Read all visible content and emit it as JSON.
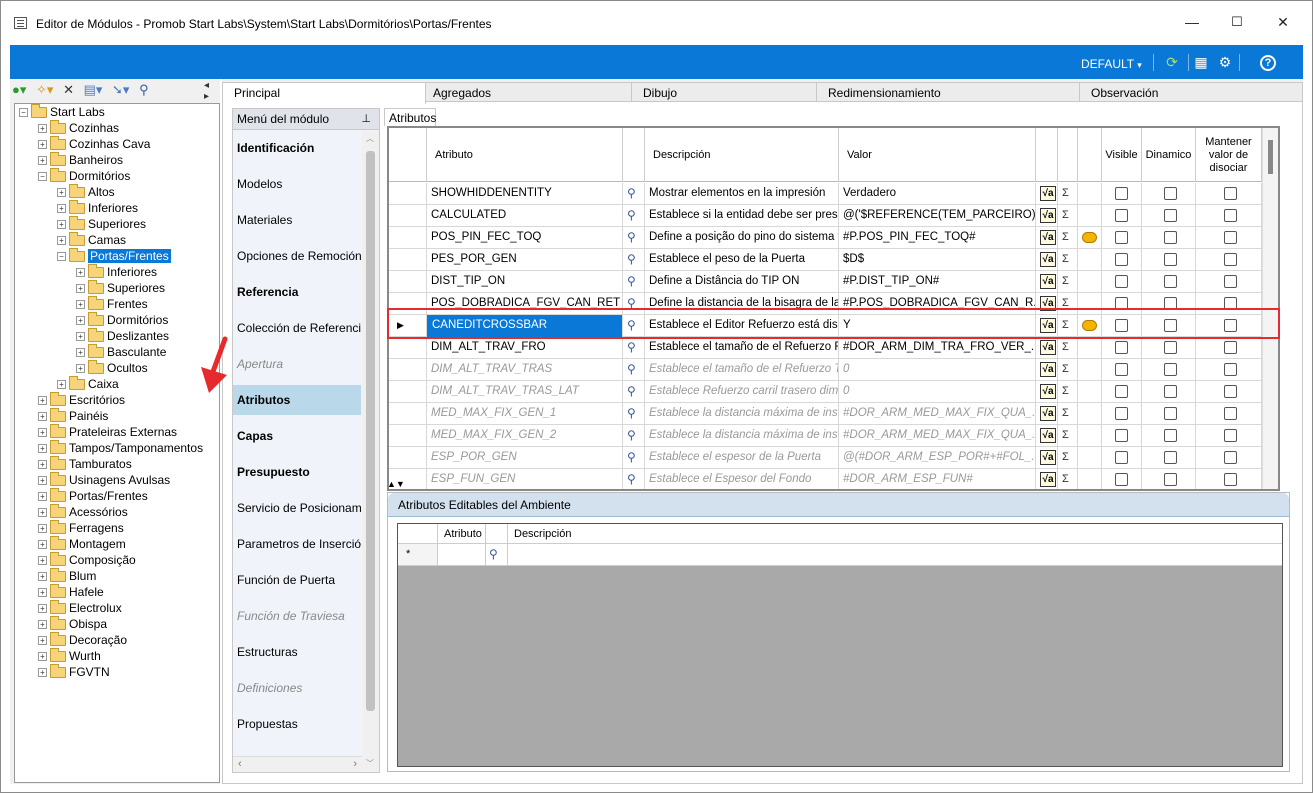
{
  "window": {
    "title": "Editor de Módulos - Promob Start Labs\\System\\Start Labs\\Dormitórios\\Portas/Frentes",
    "minimize": "—",
    "maximize": "☐",
    "close": "✕"
  },
  "topbar": {
    "profile": "DEFAULT",
    "profile_caret": "▾",
    "icons": [
      "refresh-icon",
      "layout-icon",
      "settings-icon",
      "help-icon"
    ]
  },
  "tree": {
    "items": [
      {
        "label": "Start Labs",
        "level": 0,
        "expanded": true
      },
      {
        "label": "Cozinhas",
        "level": 1
      },
      {
        "label": "Cozinhas Cava",
        "level": 1
      },
      {
        "label": "Banheiros",
        "level": 1
      },
      {
        "label": "Dormitórios",
        "level": 1,
        "expanded": true
      },
      {
        "label": "Altos",
        "level": 2
      },
      {
        "label": "Inferiores",
        "level": 2
      },
      {
        "label": "Superiores",
        "level": 2
      },
      {
        "label": "Camas",
        "level": 2
      },
      {
        "label": "Portas/Frentes",
        "level": 2,
        "expanded": true,
        "selected": true
      },
      {
        "label": "Inferiores",
        "level": 3
      },
      {
        "label": "Superiores",
        "level": 3
      },
      {
        "label": "Frentes",
        "level": 3
      },
      {
        "label": "Dormitórios",
        "level": 3
      },
      {
        "label": "Deslizantes",
        "level": 3
      },
      {
        "label": "Basculante",
        "level": 3
      },
      {
        "label": "Ocultos",
        "level": 3
      },
      {
        "label": "Caixa",
        "level": 2
      },
      {
        "label": "Escritórios",
        "level": 1
      },
      {
        "label": "Painéis",
        "level": 1
      },
      {
        "label": "Prateleiras Externas",
        "level": 1
      },
      {
        "label": "Tampos/Tamponamentos",
        "level": 1
      },
      {
        "label": "Tamburatos",
        "level": 1
      },
      {
        "label": "Usinagens Avulsas",
        "level": 1
      },
      {
        "label": "Portas/Frentes",
        "level": 1
      },
      {
        "label": "Acessórios",
        "level": 1
      },
      {
        "label": "Ferragens",
        "level": 1
      },
      {
        "label": "Montagem",
        "level": 1
      },
      {
        "label": "Composição",
        "level": 1
      },
      {
        "label": "Blum",
        "level": 1
      },
      {
        "label": "Hafele",
        "level": 1
      },
      {
        "label": "Electrolux",
        "level": 1
      },
      {
        "label": "Obispa",
        "level": 1
      },
      {
        "label": "Decoração",
        "level": 1
      },
      {
        "label": "Wurth",
        "level": 1
      },
      {
        "label": "FGVTN",
        "level": 1
      }
    ]
  },
  "tabs": [
    "Principal",
    "Agregados",
    "Dibujo",
    "Redimensionamiento",
    "Observación"
  ],
  "menu": {
    "header": "Menú del módulo",
    "items": [
      {
        "label": "Identificación",
        "style": "b"
      },
      {
        "label": "Modelos",
        "style": ""
      },
      {
        "label": "Materiales",
        "style": ""
      },
      {
        "label": "Opciones de Remoción",
        "style": ""
      },
      {
        "label": "Referencia",
        "style": "b"
      },
      {
        "label": "Colección de Referencias",
        "style": ""
      },
      {
        "label": "Apertura",
        "style": "g"
      },
      {
        "label": "Atributos",
        "style": "sel"
      },
      {
        "label": "Capas",
        "style": "b"
      },
      {
        "label": "Presupuesto",
        "style": "b"
      },
      {
        "label": "Servicio de Posicionamiento",
        "style": ""
      },
      {
        "label": "Parametros de Inserción",
        "style": ""
      },
      {
        "label": "Función de Puerta",
        "style": ""
      },
      {
        "label": "Función de Traviesa",
        "style": "g"
      },
      {
        "label": "Estructuras",
        "style": ""
      },
      {
        "label": "Definiciones",
        "style": "g"
      },
      {
        "label": "Propuestas",
        "style": ""
      }
    ]
  },
  "subtab": "Atributos",
  "grid": {
    "headers": {
      "atributo": "Atributo",
      "descripcion": "Descripción",
      "valor": "Valor",
      "visible": "Visible",
      "dinamico": "Dinamico",
      "mantener": "Mantener valor de disociar"
    },
    "rows": [
      {
        "attr": "SHOWHIDDENENTITY",
        "desc": "Mostrar elementos en la impresión",
        "val": "Verdadero",
        "i": false,
        "bubble": false
      },
      {
        "attr": "CALCULATED",
        "desc": "Establece si la entidad debe ser pres...",
        "val": "@('$REFERENCE(TEM_PARCEIRO)...",
        "i": false,
        "bubble": false
      },
      {
        "attr": "POS_PIN_FEC_TOQ",
        "desc": "Define a posição do pino do sistema f...",
        "val": "#P.POS_PIN_FEC_TOQ#",
        "i": false,
        "bubble": true
      },
      {
        "attr": "PES_POR_GEN",
        "desc": "Establece el peso de la Puerta",
        "val": "$D$",
        "i": false,
        "bubble": false
      },
      {
        "attr": "DIST_TIP_ON",
        "desc": "Define a Distância do TIP ON",
        "val": "#P.DIST_TIP_ON#",
        "i": false,
        "bubble": false
      },
      {
        "attr": "POS_DOBRADICA_FGV_CAN_RET",
        "desc": "Define la distancia de la bisagra de la...",
        "val": "#P.POS_DOBRADICA_FGV_CAN_R...",
        "i": false,
        "bubble": false
      },
      {
        "attr": "CANEDITCROSSBAR",
        "desc": "Establece el Editor Refuerzo está dis...",
        "val": "Y",
        "i": false,
        "bubble": true,
        "current": true
      },
      {
        "attr": "DIM_ALT_TRAV_FRO",
        "desc": "Establece el tamaño de el Refuerzo F...",
        "val": "#DOR_ARM_DIM_TRA_FRO_VER_...",
        "i": false,
        "bubble": false
      },
      {
        "attr": "DIM_ALT_TRAV_TRAS",
        "desc": "Establece el tamaño de el Refuerzo T...",
        "val": "0",
        "i": true,
        "bubble": false
      },
      {
        "attr": "DIM_ALT_TRAV_TRAS_LAT",
        "desc": "Establece Refuerzo carril trasero dime...",
        "val": "0",
        "i": true,
        "bubble": false
      },
      {
        "attr": "MED_MAX_FIX_GEN_1",
        "desc": "Establece la distancia máxima de inse...",
        "val": "#DOR_ARM_MED_MAX_FIX_QUA_...",
        "i": true,
        "bubble": false
      },
      {
        "attr": "MED_MAX_FIX_GEN_2",
        "desc": "Establece la distancia máxima de inse...",
        "val": "#DOR_ARM_MED_MAX_FIX_QUA_...",
        "i": true,
        "bubble": false
      },
      {
        "attr": "ESP_POR_GEN",
        "desc": "Establece el espesor de la Puerta",
        "val": "@(#DOR_ARM_ESP_POR#+#FOL_...",
        "i": true,
        "bubble": false
      },
      {
        "attr": "ESP_FUN_GEN",
        "desc": "Establece el Espesor del Fondo",
        "val": "#DOR_ARM_ESP_FUN#",
        "i": true,
        "bubble": false
      }
    ]
  },
  "attrpanel": {
    "title": "Atributos Editables del Ambiente",
    "col_attr": "Atributo",
    "col_desc": "Descripción",
    "newrow": "*"
  }
}
